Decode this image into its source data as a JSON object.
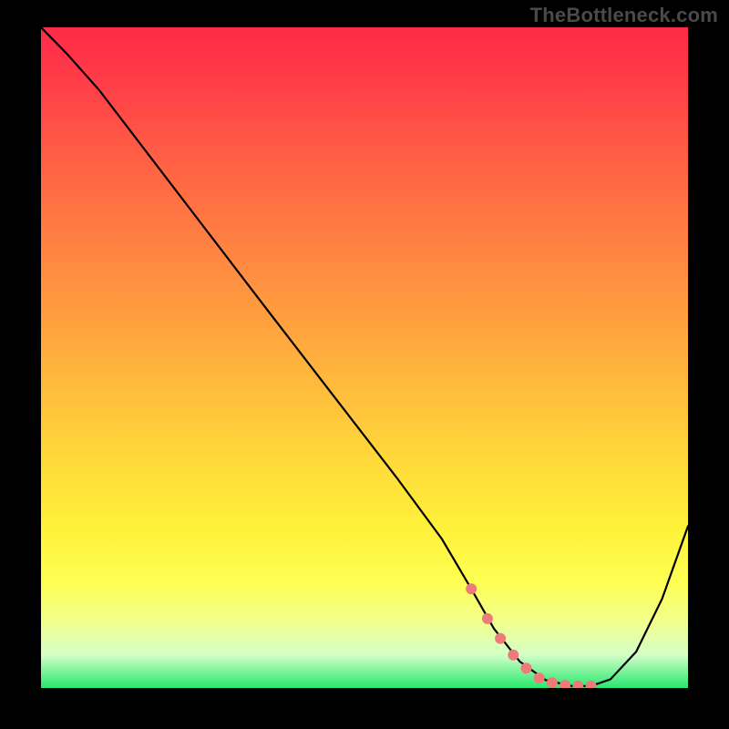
{
  "watermark": "TheBottleneck.com",
  "chart_data": {
    "type": "line",
    "title": "",
    "xlabel": "",
    "ylabel": "",
    "xlim": [
      0,
      1
    ],
    "ylim": [
      0,
      1
    ],
    "series": [
      {
        "name": "curve",
        "x": [
          0.0,
          0.04,
          0.09,
          0.15,
          0.25,
          0.35,
          0.45,
          0.55,
          0.62,
          0.665,
          0.7,
          0.74,
          0.78,
          0.82,
          0.85,
          0.88,
          0.92,
          0.96,
          1.0
        ],
        "y": [
          1.0,
          0.96,
          0.905,
          0.828,
          0.7,
          0.572,
          0.445,
          0.318,
          0.225,
          0.15,
          0.09,
          0.04,
          0.012,
          0.003,
          0.003,
          0.013,
          0.055,
          0.135,
          0.245
        ]
      }
    ],
    "markers": {
      "name": "highlighted-points",
      "color": "#ef7a7a",
      "x": [
        0.665,
        0.69,
        0.71,
        0.73,
        0.75,
        0.77,
        0.79,
        0.81,
        0.83,
        0.85
      ],
      "y": [
        0.15,
        0.105,
        0.075,
        0.05,
        0.03,
        0.015,
        0.008,
        0.004,
        0.003,
        0.003
      ]
    }
  }
}
